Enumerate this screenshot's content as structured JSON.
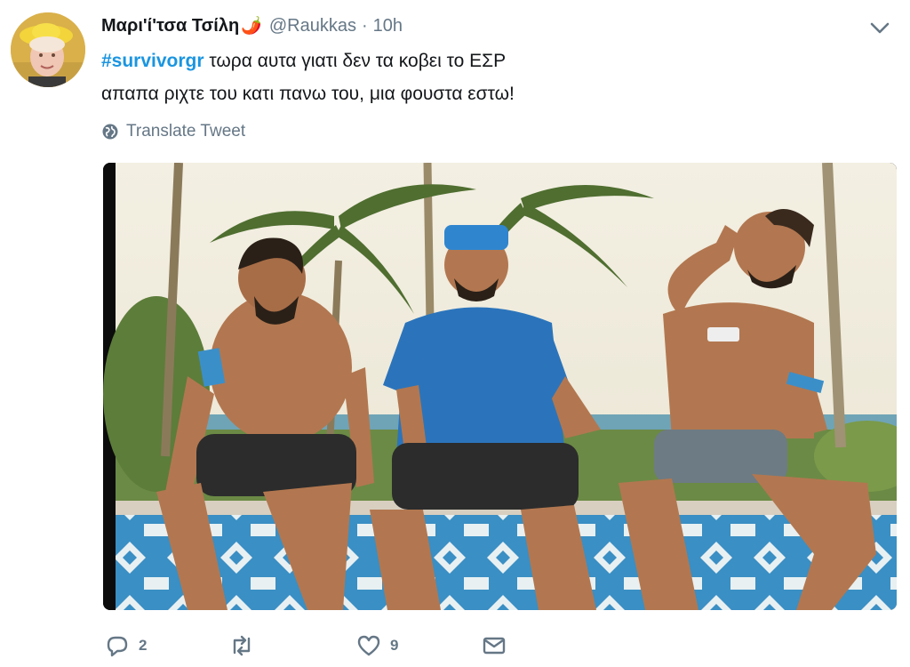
{
  "tweet": {
    "display_name": "Μαρι'ί'τσα Τσίλη",
    "name_emoji": "🌶️",
    "handle": "@Raukkas",
    "separator": "·",
    "time": "10h",
    "hashtag": "#survivorgr",
    "text_line1_rest": " τωρα αυτα γιατι δεν τα κοβει το ΕΣΡ",
    "text_line2": "απαπα ριχτε του κατι πανω του, μια φουστα εστω!",
    "translate_label": "Translate Tweet"
  },
  "actions": {
    "reply_count": "2",
    "retweet_count": "",
    "like_count": "9"
  },
  "icons": {
    "caret": "chevron-down-icon",
    "translate": "globe-icon",
    "reply": "reply-icon",
    "retweet": "retweet-icon",
    "like": "heart-icon",
    "dm": "envelope-icon"
  },
  "colors": {
    "link": "#1b95e0",
    "muted": "#657786",
    "text": "#14171a"
  }
}
